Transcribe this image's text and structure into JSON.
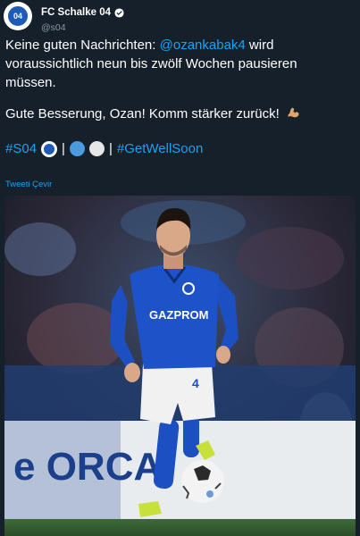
{
  "account": {
    "display_name": "FC Schalke 04",
    "handle": "@s04",
    "crest_text": "04"
  },
  "tweet": {
    "line1_prefix": "Keine guten Nachrichten: ",
    "mention": "@ozankabak4",
    "line1_suffix": " wird",
    "line2": "voraussichtlich neun bis zwölf Wochen pausieren",
    "line3": "müssen.",
    "line4": "Gute Besserung, Ozan! Komm stärker zurück!",
    "hashtag1": "#S04",
    "separator": "|",
    "hashtag2": "#GetWellSoon",
    "emoji": [
      "muscle-emoji",
      "schalke-emoji",
      "blue-circle",
      "white-circle"
    ]
  },
  "translate_label": "Tweeti Çevir",
  "photo": {
    "jersey_sponsor": "GAZPROM",
    "shorts_number": "4",
    "board_text": "e  ORCA"
  },
  "colors": {
    "background": "#15202b",
    "link": "#1da1f2",
    "secondary_text": "#8899a6",
    "jersey_blue": "#1c4fc2"
  }
}
